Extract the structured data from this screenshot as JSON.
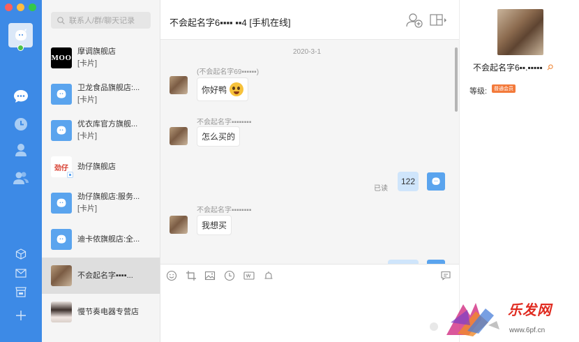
{
  "search": {
    "placeholder": "联系人/群/聊天记录"
  },
  "contacts": [
    {
      "name": "摩调旗舰店",
      "sub": "[卡片]",
      "avatar": "MOO"
    },
    {
      "name": "卫龙食品旗舰店:...",
      "sub": "[卡片]",
      "avatar": "blue"
    },
    {
      "name": "优衣库官方旗舰...",
      "sub": "[卡片]",
      "avatar": "blue"
    },
    {
      "name": "劲仔旗舰店",
      "sub": "",
      "avatar": "劲仔"
    },
    {
      "name": "劲仔旗舰店:服务...",
      "sub": "[卡片]",
      "avatar": "blue"
    },
    {
      "name": "迪卡侬旗舰店:全...",
      "sub": "",
      "avatar": "blue"
    },
    {
      "name": "不会起名字▪▪▪▪...",
      "sub": "",
      "avatar": "user"
    },
    {
      "name": "慢节奏电器专营店",
      "sub": "",
      "avatar": "girl"
    }
  ],
  "chat": {
    "title": "不会起名字6▪▪▪▪ ▪▪4 [手机在线]",
    "date": "2020-3-1",
    "messages": [
      {
        "sender": "(不会起名字69▪▪▪▪▪▪)",
        "text": "你好鸭",
        "emoji": true
      },
      {
        "sender": "不会起名字▪▪▪▪▪▪▪▪",
        "text": "怎么买的"
      },
      {
        "sender": "不会起名字▪▪▪▪▪▪▪▪",
        "text": "我想买"
      }
    ],
    "self_message": {
      "text": "122",
      "status": "已读"
    }
  },
  "profile": {
    "name": "不会起名字6▪▪.▪▪▪▪▪",
    "level_label": "等级:",
    "level_badge": "普通会员"
  },
  "watermark": {
    "brand": "乐发网",
    "url": "www.6pf.cn"
  },
  "colors": {
    "rail": "#3d8ae6",
    "accent": "#5aa4ee",
    "self_bubble": "#cfe5fb"
  }
}
